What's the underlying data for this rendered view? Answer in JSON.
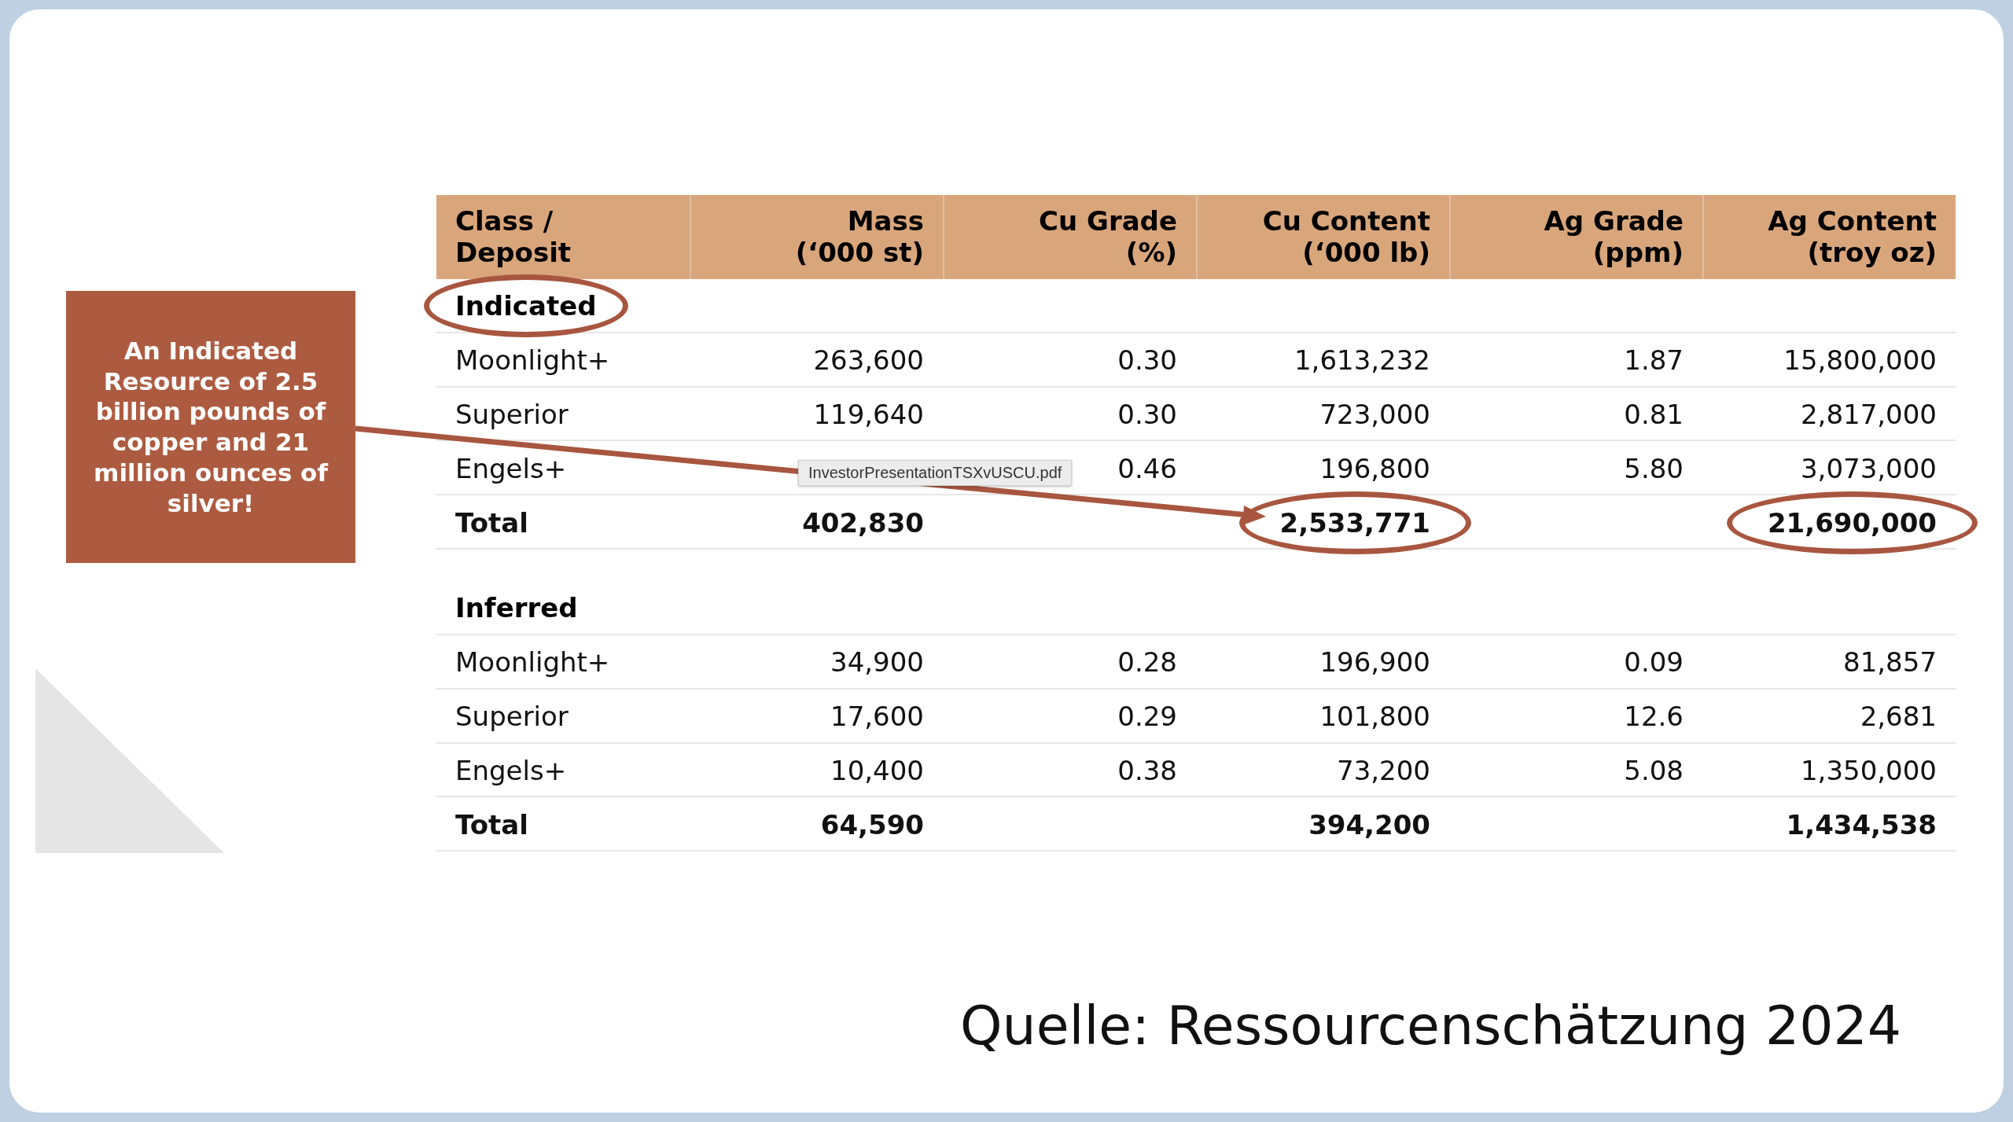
{
  "callout": "An Indicated Resource of 2.5 billion pounds of copper and 21 million ounces of silver!",
  "table": {
    "columns": [
      "Class / Deposit",
      "Mass\n(‘000 st)",
      "Cu Grade\n(%)",
      "Cu Content\n(‘000 lb)",
      "Ag Grade\n(ppm)",
      "Ag Content\n(troy oz)"
    ],
    "sections": [
      {
        "label": "Indicated",
        "circled": true,
        "rows": [
          {
            "kind": "item",
            "cells": [
              "Moonlight+",
              "263,600",
              "0.30",
              "1,613,232",
              "1.87",
              "15,800,000"
            ]
          },
          {
            "kind": "item",
            "cells": [
              "Superior",
              "119,640",
              "0.30",
              "723,000",
              "0.81",
              "2,817,000"
            ]
          },
          {
            "kind": "item",
            "cells": [
              "Engels+",
              null,
              "0.46",
              "196,800",
              "5.80",
              "3,073,000"
            ]
          },
          {
            "kind": "total",
            "cells": [
              {
                "text": "Total",
                "circled": false
              },
              {
                "text": "402,830",
                "circled": false
              },
              null,
              {
                "text": "2,533,771",
                "circled": true
              },
              null,
              {
                "text": "21,690,000",
                "circled": true
              }
            ]
          }
        ]
      },
      {
        "label": "Inferred",
        "circled": false,
        "rows": [
          {
            "kind": "item",
            "cells": [
              "Moonlight+",
              "34,900",
              "0.28",
              "196,900",
              "0.09",
              "81,857"
            ]
          },
          {
            "kind": "item",
            "cells": [
              "Superior",
              "17,600",
              "0.29",
              "101,800",
              "12.6",
              "2,681"
            ]
          },
          {
            "kind": "item",
            "cells": [
              "Engels+",
              "10,400",
              "0.38",
              "73,200",
              "5.08",
              "1,350,000"
            ]
          },
          {
            "kind": "total",
            "cells": [
              {
                "text": "Total",
                "circled": false
              },
              {
                "text": "64,590",
                "circled": false
              },
              null,
              {
                "text": "394,200",
                "circled": false
              },
              null,
              {
                "text": "1,434,538",
                "circled": false
              }
            ]
          }
        ]
      }
    ]
  },
  "tooltip": "InvestorPresentationTSXvUSCU.pdf",
  "source": "Quelle: Ressourcenschätzung 2024"
}
